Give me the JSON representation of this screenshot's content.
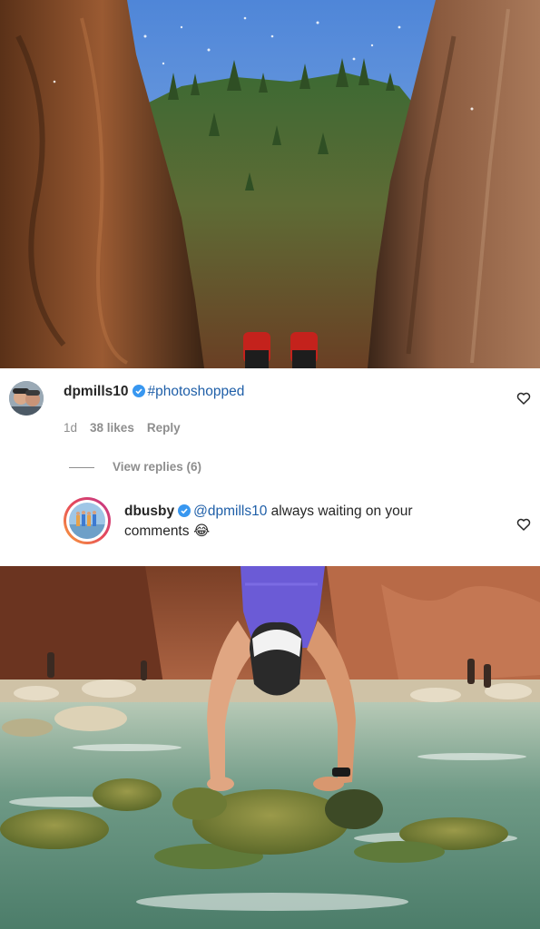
{
  "comments": [
    {
      "username": "dpmills10",
      "hashtag": "#photoshopped",
      "time": "1d",
      "likes": "38 likes",
      "reply_label": "Reply",
      "view_replies": "View replies (6)"
    },
    {
      "username": "dbusby",
      "mention": "@dpmills10",
      "text_line1": " always waiting on your",
      "text_line2": "comments",
      "emoji": "😂"
    }
  ],
  "colors": {
    "verified_badge": "#3897f0",
    "mention": "#1f5fa8",
    "meta_text": "#8e8e8e",
    "story_ring_start": "#f9a23a",
    "story_ring_end": "#c1358b"
  },
  "icons": {
    "verified": "verified-badge-icon",
    "like": "heart-outline-icon"
  }
}
